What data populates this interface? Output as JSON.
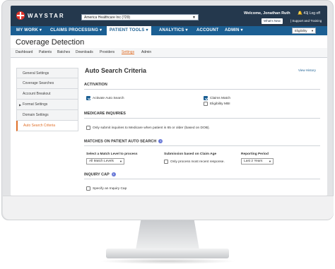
{
  "header": {
    "logo_text": "WAYSTAR",
    "org": "America Healthcare Inc (729)",
    "welcome": "Welcome, Jonathan Ruth",
    "notifications": "41",
    "logoff": "Log off",
    "whats_new": "What's New",
    "support": "Support and Training",
    "eligibility": "Eligibility"
  },
  "nav": {
    "items": [
      "MY WORK",
      "CLAIMS PROCESSING",
      "PATIENT TOOLS",
      "ANALYTICS",
      "ACCOUNT",
      "ADMIN"
    ]
  },
  "page": {
    "title": "Coverage Detection",
    "subnav": [
      "Dashboard",
      "Patients",
      "Batches",
      "Downloads",
      "Providers",
      "Settings",
      "Admin"
    ]
  },
  "sidebar": {
    "items": [
      "General Settings",
      "Coverage Searches",
      "Account Breakout",
      "Format Settings",
      "Domain Settings",
      "Auto Search Criteria"
    ]
  },
  "main": {
    "title": "Auto Search Criteria",
    "view_history": "View History",
    "activation": {
      "header": "ACTIVATION",
      "activate_auto_search": "Activate Auto Search",
      "claims_match": "Claims Match",
      "eligibility_mbi": "Eligibility MBI"
    },
    "medicare": {
      "header": "MEDICARE INQUIRIES",
      "option": "Only submit inquiries to Medicare when patient is 65 or older (based on DOB)."
    },
    "matches": {
      "header": "MATCHES ON PATIENT AUTO SEARCH",
      "match_level_label": "Select a Match Level to process",
      "match_level_value": "All Match Levels",
      "claim_age_label": "Submission based on Claim Age",
      "claim_age_option": "Only process most recent response.",
      "reporting_period_label": "Reporting Period",
      "reporting_period_value": "Last 2 Years"
    },
    "inquiry_cap": {
      "header": "INQUIRY CAP",
      "option": "Specify an Inquiry Cap"
    }
  },
  "colors": {
    "topbar": "#24384d",
    "navbar": "#1b5f93",
    "accent": "#e0702a",
    "brand_red": "#e3332a"
  }
}
